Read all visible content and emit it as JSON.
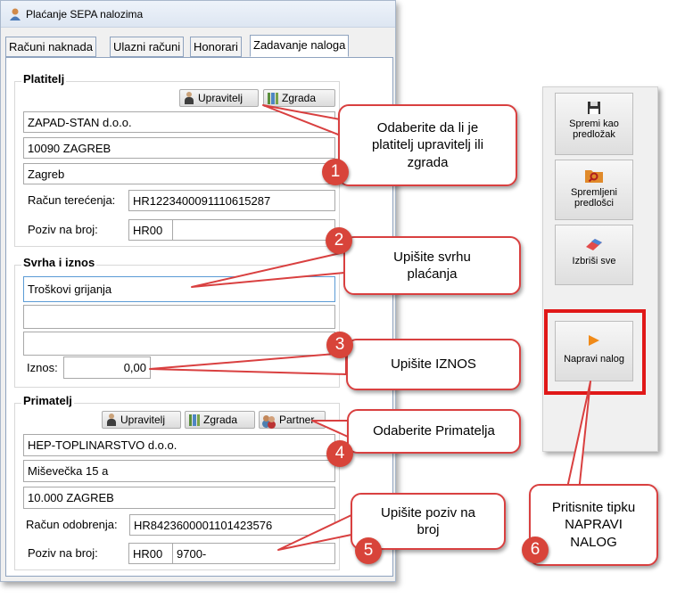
{
  "window": {
    "title": "Plaćanje SEPA nalozima"
  },
  "tabs": [
    "Računi naknada",
    "Ulazni računi",
    "Honorari",
    "Zadavanje naloga"
  ],
  "platitelj": {
    "title": "Platitelj",
    "btn_upravitelj": "Upravitelj",
    "btn_zgrada": "Zgrada",
    "name": "ZAPAD-STAN d.o.o.",
    "postal": "10090 ZAGREB",
    "city": "Zagreb",
    "racun_label": "Račun terećenja:",
    "racun": "HR1223400091110615287",
    "poziv_label": "Poziv na broj:",
    "poziv_model": "HR00",
    "poziv_broj": ""
  },
  "svrha": {
    "title": "Svrha i iznos",
    "line1": "Troškovi grijanja",
    "line2": "",
    "line3": "",
    "iznos_label": "Iznos:",
    "iznos": "0,00"
  },
  "primatelj": {
    "title": "Primatelj",
    "btn_upravitelj": "Upravitelj",
    "btn_zgrada": "Zgrada",
    "btn_partner": "Partner",
    "name": "HEP-TOPLINARSTVO d.o.o.",
    "street": "Miševečka 15 a",
    "postal": "10.000 ZAGREB",
    "racun_label": "Račun odobrenja:",
    "racun": "HR8423600001101423576",
    "poziv_label": "Poziv na broj:",
    "poziv_model": "HR00",
    "poziv_broj": "9700-"
  },
  "side": {
    "spremi": "Spremi kao predložak",
    "spremljeni": "Spremljeni predlošci",
    "izbrisi": "Izbriši sve",
    "napravi": "Napravi nalog"
  },
  "callouts": [
    {
      "num": "1",
      "text": "Odaberite da li je platitelj upravitelj ili zgrada"
    },
    {
      "num": "2",
      "text": "Upišite svrhu plaćanja"
    },
    {
      "num": "3",
      "text": "Upišite IZNOS"
    },
    {
      "num": "4",
      "text": "Odaberite Primatelja"
    },
    {
      "num": "5",
      "text": "Upišite poziv na broj"
    },
    {
      "num": "6",
      "text": "Pritisnite tipku NAPRAVI NALOG"
    }
  ],
  "colors": {
    "callout_border": "#d94040",
    "badge": "#d8443a",
    "highlight": "#e01818"
  }
}
